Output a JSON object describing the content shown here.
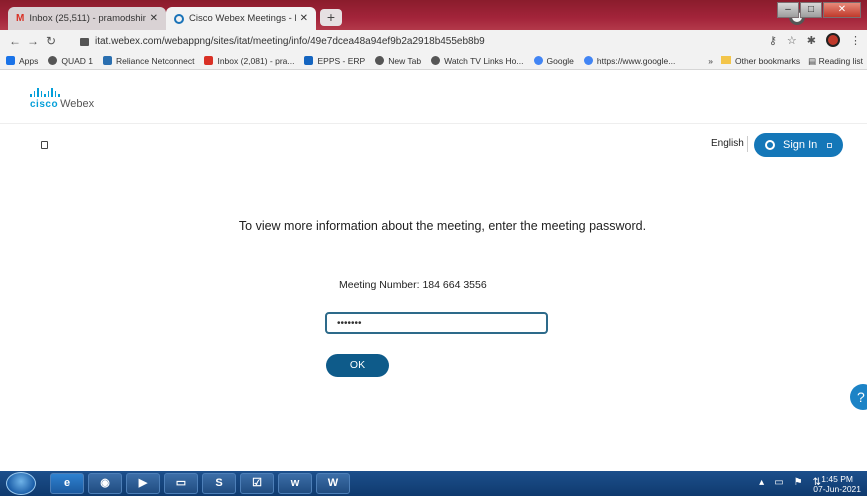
{
  "browser": {
    "tabs": [
      {
        "label": "Inbox (25,511) - pramodshingte@",
        "icon": "gmail-icon"
      },
      {
        "label": "Cisco Webex Meetings - Meeting",
        "icon": "webex-icon"
      }
    ],
    "url": "itat.webex.com/webappng/sites/itat/meeting/info/49e7dcea48a94ef9b2a2918b455eb8b9",
    "bookmarks": [
      {
        "label": "Apps",
        "icon": "apps-grid-icon"
      },
      {
        "label": "QUAD 1",
        "icon": "globe-icon"
      },
      {
        "label": "Reliance Netconnect",
        "icon": "reliance-icon"
      },
      {
        "label": "Inbox (2,081) - pra...",
        "icon": "gmail-icon"
      },
      {
        "label": "EPPS - ERP",
        "icon": "edge-e-icon"
      },
      {
        "label": "New Tab",
        "icon": "globe-icon"
      },
      {
        "label": "Watch TV Links Ho...",
        "icon": "globe-icon"
      },
      {
        "label": "Google",
        "icon": "google-g-icon"
      },
      {
        "label": "https://www.google...",
        "icon": "google-g-icon"
      }
    ],
    "bookmarks_right": {
      "overflow": "»",
      "other": "Other bookmarks",
      "reading": "Reading list"
    }
  },
  "webex": {
    "logo_cisco": "cisco",
    "logo_product": "Webex",
    "language": "English",
    "signin_label": "Sign In",
    "prompt": "To view more information about the meeting, enter the meeting password.",
    "meeting_number": "Meeting Number: 184 664 3556",
    "password_value": "•••••••",
    "ok_label": "OK",
    "help_label": "?"
  },
  "taskbar": {
    "time": "1:45 PM",
    "date": "07-Jun-2021"
  },
  "colors": {
    "accent": "#1477b8",
    "ok_button": "#0e5b8a",
    "window_frame": "#a3243a"
  }
}
